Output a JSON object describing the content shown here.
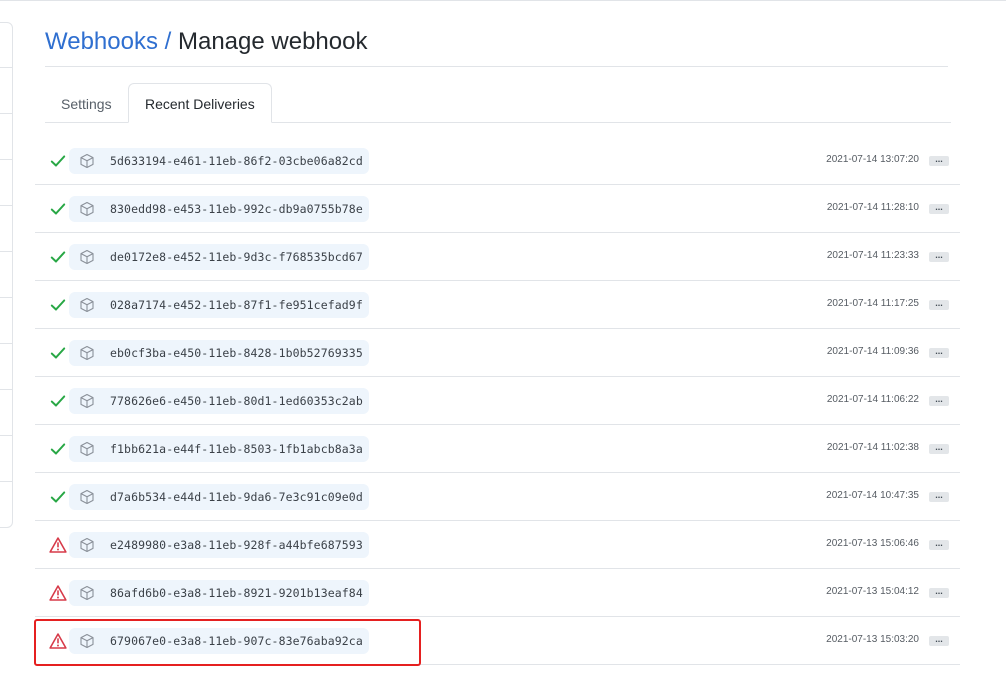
{
  "breadcrumb": {
    "parent": "Webhooks",
    "separator": "/",
    "current": "Manage webhook"
  },
  "tabs": [
    {
      "label": "Settings",
      "active": false
    },
    {
      "label": "Recent Deliveries",
      "active": true
    }
  ],
  "more_label": "...",
  "status_colors": {
    "success": "#28a745",
    "error": "#d73a49"
  },
  "deliveries": [
    {
      "status": "success",
      "status_icon": "check-icon",
      "guid": "5d633194-e461-11eb-86f2-03cbe06a82cd",
      "timestamp": "2021-07-14 13:07:20"
    },
    {
      "status": "success",
      "status_icon": "check-icon",
      "guid": "830edd98-e453-11eb-992c-db9a0755b78e",
      "timestamp": "2021-07-14 11:28:10"
    },
    {
      "status": "success",
      "status_icon": "check-icon",
      "guid": "de0172e8-e452-11eb-9d3c-f768535bcd67",
      "timestamp": "2021-07-14 11:23:33"
    },
    {
      "status": "success",
      "status_icon": "check-icon",
      "guid": "028a7174-e452-11eb-87f1-fe951cefad9f",
      "timestamp": "2021-07-14 11:17:25"
    },
    {
      "status": "success",
      "status_icon": "check-icon",
      "guid": "eb0cf3ba-e450-11eb-8428-1b0b52769335",
      "timestamp": "2021-07-14 11:09:36"
    },
    {
      "status": "success",
      "status_icon": "check-icon",
      "guid": "778626e6-e450-11eb-80d1-1ed60353c2ab",
      "timestamp": "2021-07-14 11:06:22"
    },
    {
      "status": "success",
      "status_icon": "check-icon",
      "guid": "f1bb621a-e44f-11eb-8503-1fb1abcb8a3a",
      "timestamp": "2021-07-14 11:02:38"
    },
    {
      "status": "success",
      "status_icon": "check-icon",
      "guid": "d7a6b534-e44d-11eb-9da6-7e3c91c09e0d",
      "timestamp": "2021-07-14 10:47:35"
    },
    {
      "status": "error",
      "status_icon": "alert-icon",
      "guid": "e2489980-e3a8-11eb-928f-a44bfe687593",
      "timestamp": "2021-07-13 15:06:46"
    },
    {
      "status": "error",
      "status_icon": "alert-icon",
      "guid": "86afd6b0-e3a8-11eb-8921-9201b13eaf84",
      "timestamp": "2021-07-13 15:04:12"
    },
    {
      "status": "error",
      "status_icon": "alert-icon",
      "guid": "679067e0-e3a8-11eb-907c-83e76aba92ca",
      "timestamp": "2021-07-13 15:03:20",
      "highlighted": true
    }
  ]
}
